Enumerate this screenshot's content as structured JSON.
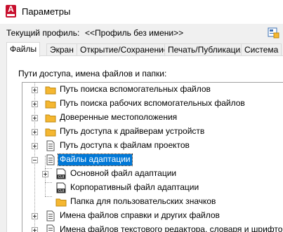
{
  "window": {
    "title": "Параметры",
    "app_icon_letter": "A"
  },
  "profile": {
    "label": "Текущий профиль:",
    "name": "<<Профиль без имени>>"
  },
  "tabs": [
    {
      "label": "Файлы",
      "active": true
    },
    {
      "label": "Экран",
      "active": false
    },
    {
      "label": "Открытие/Сохранение",
      "active": false
    },
    {
      "label": "Печать/Публикация",
      "active": false
    },
    {
      "label": "Система",
      "active": false
    }
  ],
  "files_panel": {
    "section_label": "Пути доступа, имена файлов и папки:",
    "tree": [
      {
        "label": "Путь поиска вспомогательных файлов",
        "icon": "folder-icon",
        "level": 0,
        "expander": "plus"
      },
      {
        "label": "Путь поиска рабочих вспомогательных файлов",
        "icon": "folder-icon",
        "level": 0,
        "expander": "plus"
      },
      {
        "label": "Доверенные местоположения",
        "icon": "folder-icon",
        "level": 0,
        "expander": "plus"
      },
      {
        "label": "Путь доступа к драйверам устройств",
        "icon": "folder-icon",
        "level": 0,
        "expander": "plus"
      },
      {
        "label": "Путь доступа к файлам проектов",
        "icon": "document-icon",
        "level": 0,
        "expander": "plus"
      },
      {
        "label": "Файлы адаптации",
        "icon": "document-icon",
        "level": 0,
        "expander": "minus",
        "selected": true
      },
      {
        "label": "Основной файл адаптации",
        "icon": "cui-file-icon",
        "level": 1,
        "expander": "plus"
      },
      {
        "label": "Корпоративный файл адаптации",
        "icon": "cui-file-icon",
        "level": 1,
        "expander": "none"
      },
      {
        "label": "Папка для пользовательских значков",
        "icon": "folder-icon",
        "level": 1,
        "expander": "none"
      },
      {
        "label": "Имена файлов справки и других файлов",
        "icon": "document-icon",
        "level": 0,
        "expander": "plus"
      },
      {
        "label": "Имена файлов текстового редактора, словаря и шрифтов",
        "icon": "document-icon",
        "level": 0,
        "expander": "plus"
      }
    ]
  },
  "colors": {
    "selection": "#0078d7",
    "folder": "#f5b731",
    "app_red": "#c8102e"
  }
}
